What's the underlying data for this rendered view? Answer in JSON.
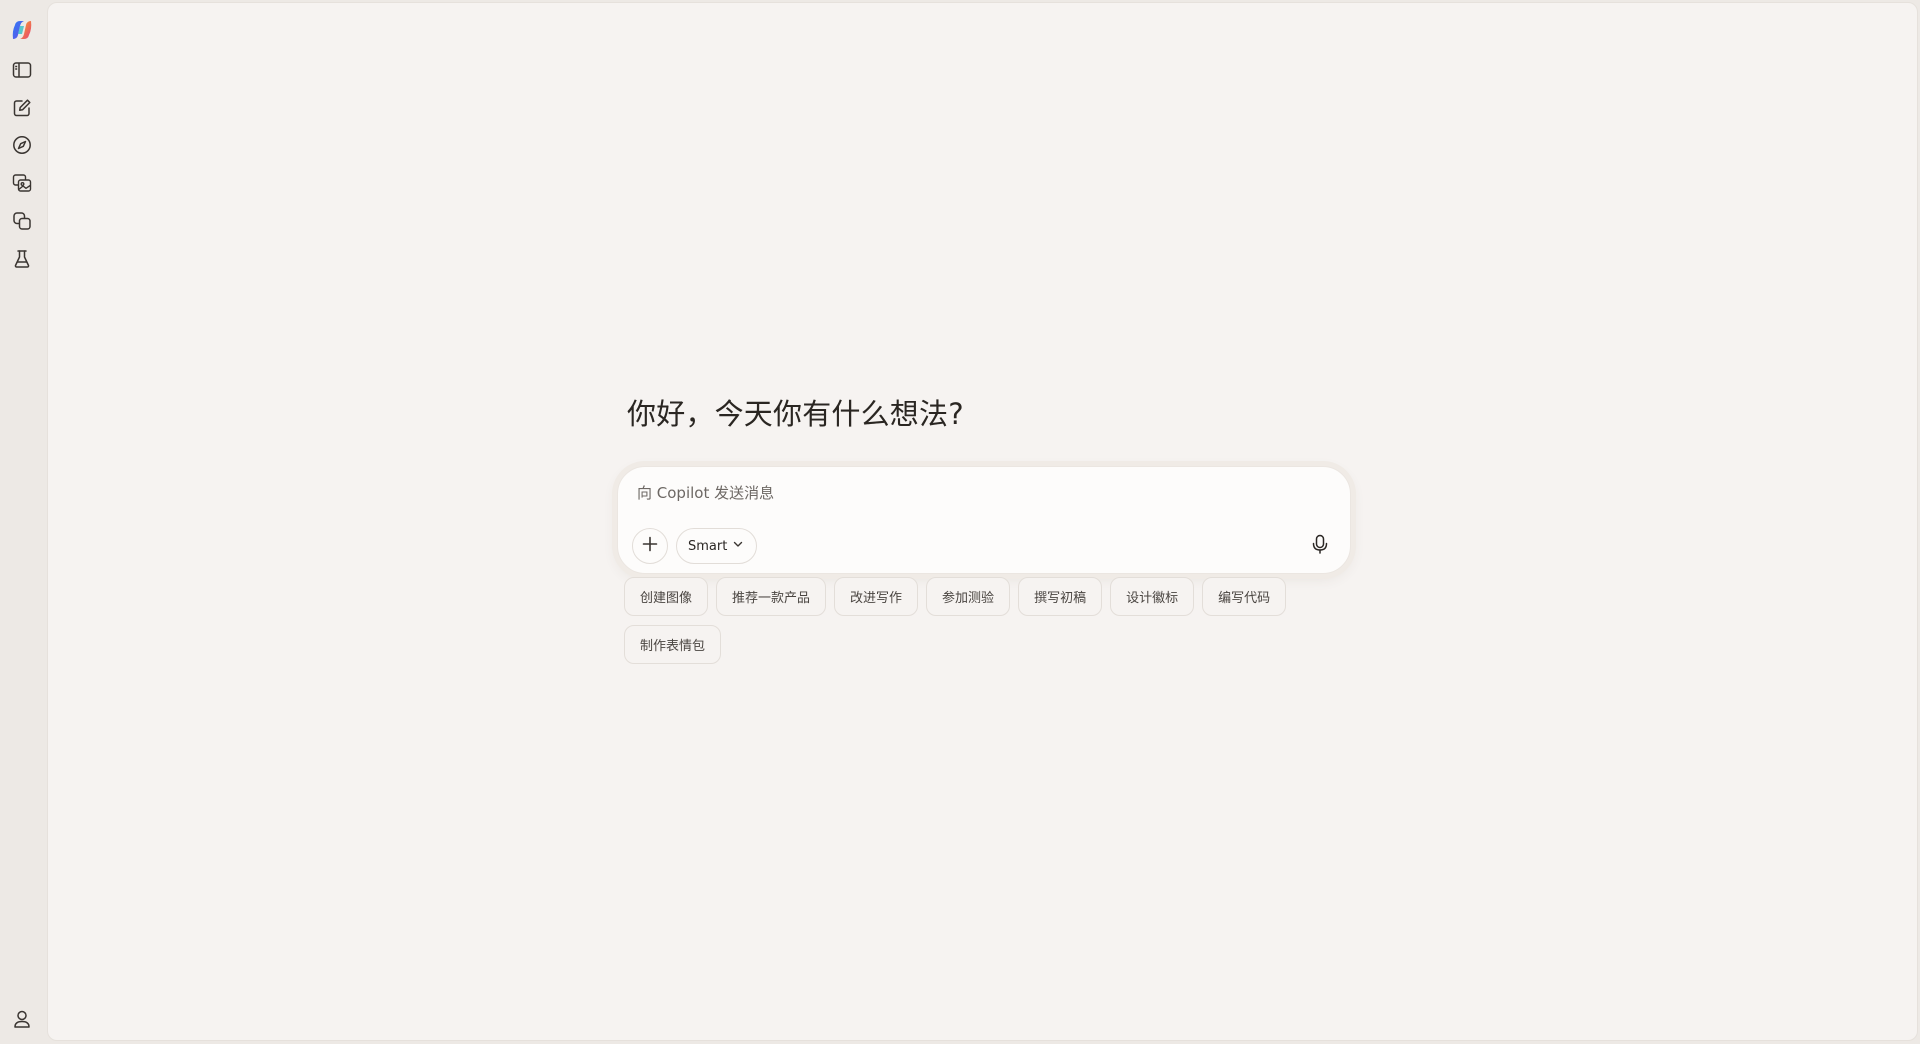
{
  "greeting": "你好，今天你有什么想法?",
  "composer": {
    "placeholder": "向 Copilot 发送消息",
    "value": "",
    "mode_label": "Smart"
  },
  "suggestions": [
    "创建图像",
    "推荐一款产品",
    "改进写作",
    "参加测验",
    "撰写初稿",
    "设计徽标",
    "编写代码",
    "制作表情包"
  ],
  "sidebar": {
    "items": [
      {
        "icon": "copilot-logo-icon"
      },
      {
        "icon": "sidebar-toggle-icon"
      },
      {
        "icon": "new-chat-icon"
      },
      {
        "icon": "discover-icon"
      },
      {
        "icon": "image-gallery-icon"
      },
      {
        "icon": "pages-icon"
      },
      {
        "icon": "labs-flask-icon"
      }
    ],
    "bottom": {
      "icon": "profile-icon"
    }
  },
  "colors": {
    "rail_bg": "#ede9e5",
    "main_bg": "#f6f3f1",
    "composer_bg": "#fdfcfb",
    "text": "#2a2622"
  }
}
